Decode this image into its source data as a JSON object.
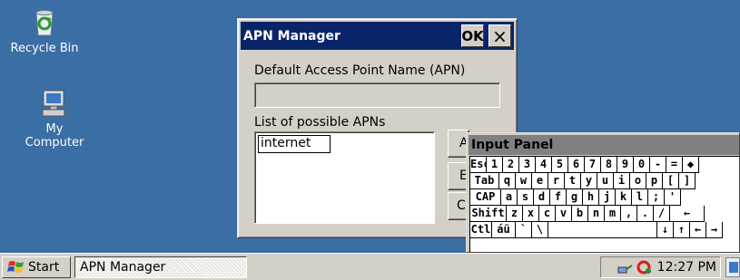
{
  "desktop": {
    "recycle_bin_label": "Recycle Bin",
    "my_computer_label_line1": "My",
    "my_computer_label_line2": "Computer"
  },
  "apn_dialog": {
    "title": "APN Manager",
    "ok_label": "OK",
    "close_label": "×",
    "default_apn_label": "Default Access Point Name (APN)",
    "default_apn_value": "",
    "list_label": "List of possible APNs",
    "list_items": [
      "internet"
    ],
    "button_add_partial": "A",
    "button_edit_partial": "E",
    "button_third_partial": "C"
  },
  "input_panel": {
    "title": "Input Panel",
    "rows": [
      [
        "Esc",
        "1",
        "2",
        "3",
        "4",
        "5",
        "6",
        "7",
        "8",
        "9",
        "0",
        "-",
        "=",
        "◆"
      ],
      [
        "Tab",
        "q",
        "w",
        "e",
        "r",
        "t",
        "y",
        "u",
        "i",
        "o",
        "p",
        "[",
        "]"
      ],
      [
        "CAP",
        "a",
        "s",
        "d",
        "f",
        "g",
        "h",
        "j",
        "k",
        "l",
        ";",
        "'"
      ],
      [
        "Shift",
        "z",
        "x",
        "c",
        "v",
        "b",
        "n",
        "m",
        ",",
        ".",
        "/",
        "←"
      ],
      [
        "Ctl",
        "áü",
        "`",
        "\\",
        "",
        "↓",
        "↑",
        "←",
        "→"
      ]
    ]
  },
  "taskbar": {
    "start_label": "Start",
    "task_label": "APN Manager",
    "clock": "12:27 PM"
  },
  "colors": {
    "desktop": "#3a6ea5",
    "title_active": "#0a246a",
    "title_inactive": "#808080",
    "face": "#d4d0c8"
  }
}
